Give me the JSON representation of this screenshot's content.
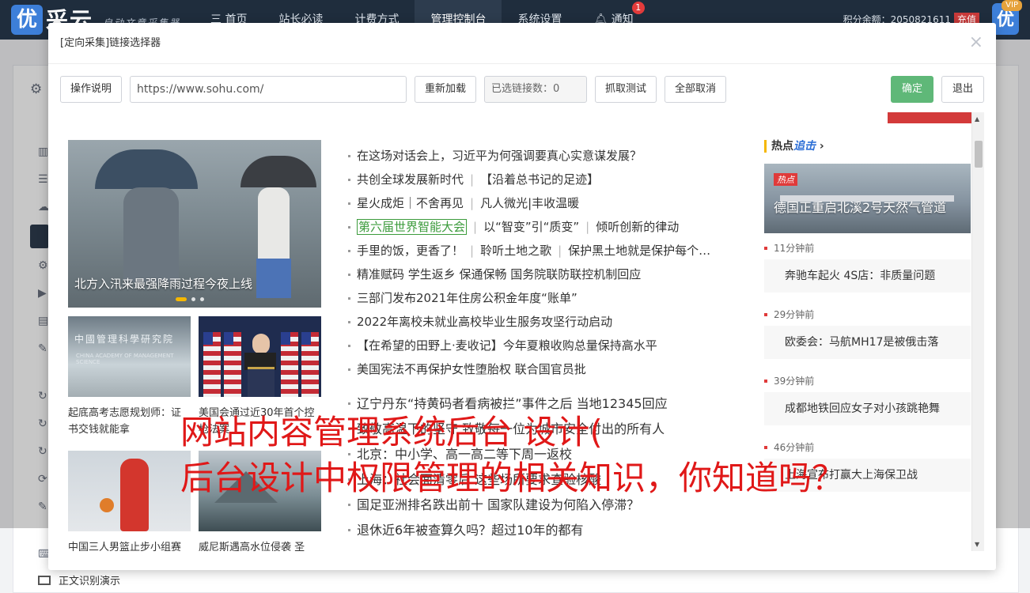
{
  "topbar": {
    "logo_text": "优",
    "brand": "采云",
    "slogan": "自动文章采集器",
    "nav": [
      "三 首页",
      "站长必读",
      "计费方式",
      "管理控制台",
      "系统设置",
      "通知"
    ],
    "notice_count": "1",
    "credits_label": "积分余额：2050821611",
    "recharge": "充值",
    "vip_tag": "VIP",
    "vip_logo": "优"
  },
  "background": {
    "footer_item": "正文识别演示"
  },
  "modal": {
    "title": "[定向采集]链接选择器",
    "close": "×",
    "toolbar": {
      "help": "操作说明",
      "url": "https://www.sohu.com/",
      "reload": "重新加载",
      "selected": "已选链接数：0",
      "test": "抓取测试",
      "cancel_all": "全部取消",
      "ok": "确定",
      "exit": "退出"
    }
  },
  "frame": {
    "hero_caption": "北方入汛来最强降雨过程今夜上线",
    "thumb1_sign": "中國管理科學研究院",
    "thumb1_sign_en": "CHINA ACADEMY OF MANAGEMENT SCIENCE",
    "thumb1_caption": "起底高考志愿规划师：证书交钱就能拿",
    "thumb2_caption": "美国会通过近30年首个控枪法案",
    "thumb3_caption": "中国三人男篮止步小组赛",
    "thumb4_caption": "威尼斯遇高水位侵袭 圣",
    "news": [
      [
        "在这场对话会上，习近平为何强调要真心实意谋发展？"
      ],
      [
        "共创全球发展新时代",
        "【沿着总书记的足迹】"
      ],
      [
        "星火成炬｜不舍再见",
        "凡人微光|丰收温暖"
      ],
      [
        "第六届世界智能大会",
        "以“智变”引“质变”",
        "倾听创新的律动"
      ],
      [
        "手里的饭，更香了！",
        "聆听土地之歌",
        "保护黑土地就是保护每个…"
      ],
      [
        "精准赋码 学生返乡 保通保畅 国务院联防联控机制回应"
      ],
      [
        "三部门发布2021年住房公积金年度“账单”"
      ],
      [
        "2022年离校未就业高校毕业生服务攻坚行动启动"
      ],
      [
        "【在希望的田野上·麦收记】今年夏粮收购总量保持高水平"
      ],
      [
        "美国宪法不再保护女性堕胎权 联合国官员批"
      ]
    ],
    "news2": [
      "辽宁丹东“持黄码者看病被拦”事件之后 当地12345回应",
      "致敬高温下的坚守 致敬每一位为城市安全付出的所有人",
      "北京：中小学、高一高二等下周一返校",
      "上海：社会面清零后 这些场所要求查验核酸",
      "国足亚洲排名跌出前十 国家队建设为何陷入停滞？",
      "退休近6年被查算久吗？超过10年的都有"
    ],
    "hot_title_a": "热点",
    "hot_title_b": "追击",
    "hot_title_arrow": "›",
    "hot_tag": "热点",
    "hot_caption": "德国正重启北溪2号天然气管道",
    "hot_items": [
      {
        "time": "11分钟前",
        "text": "奔驰车起火 4S店：非质量问题"
      },
      {
        "time": "29分钟前",
        "text": "欧委会：马航MH17是被俄击落"
      },
      {
        "time": "39分钟前",
        "text": "成都地铁回应女子对小孩跳艳舞"
      },
      {
        "time": "46分钟前",
        "text": "上海宣布打赢大上海保卫战"
      }
    ]
  },
  "watermark": {
    "line1": "网站内容管理系统后台 设计(",
    "line2": "后台设计中权限管理的相关知识，你知道吗？"
  },
  "colors": {
    "topbar": "#1f2d3d",
    "ok_button": "#5fb878",
    "watermark": "#e01818",
    "highlight": "#3b9b3b"
  }
}
